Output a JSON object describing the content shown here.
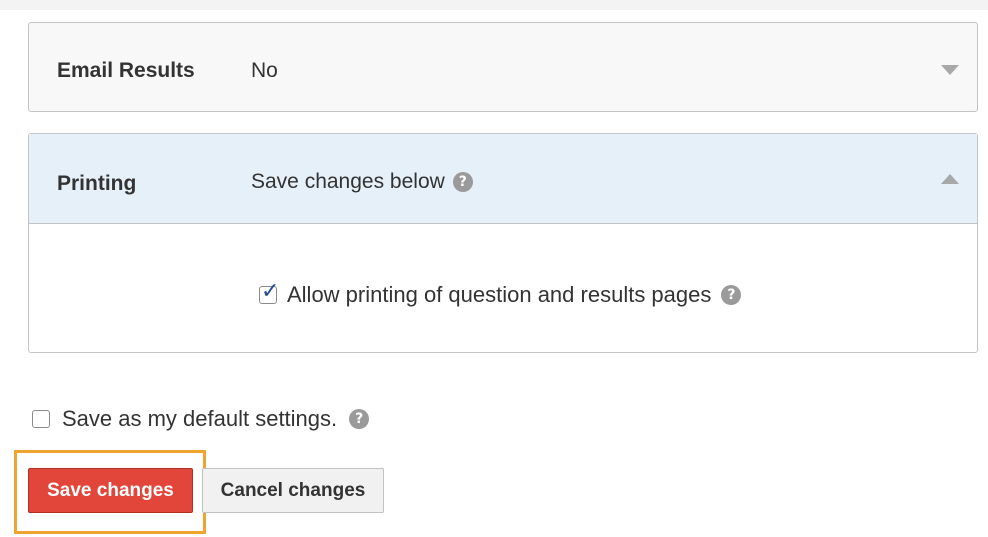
{
  "email_results": {
    "label": "Email Results",
    "value": "No",
    "expander_icon": "chevron-down-icon"
  },
  "printing": {
    "label": "Printing",
    "value": "Save changes below",
    "value_help_icon": "question-circle-icon",
    "expander_icon": "chevron-up-icon",
    "allow_printing": {
      "label": "Allow printing of question and results pages",
      "checked": true,
      "help_icon": "question-circle-icon"
    }
  },
  "default_settings": {
    "label": "Save as my default settings.",
    "checked": false,
    "help_icon": "question-circle-icon"
  },
  "buttons": {
    "save_label": "Save changes",
    "cancel_label": "Cancel changes"
  },
  "colors": {
    "save_button": "#e2463a",
    "highlight_border": "#f0a430",
    "printing_header_bg": "#e5f0f9"
  }
}
